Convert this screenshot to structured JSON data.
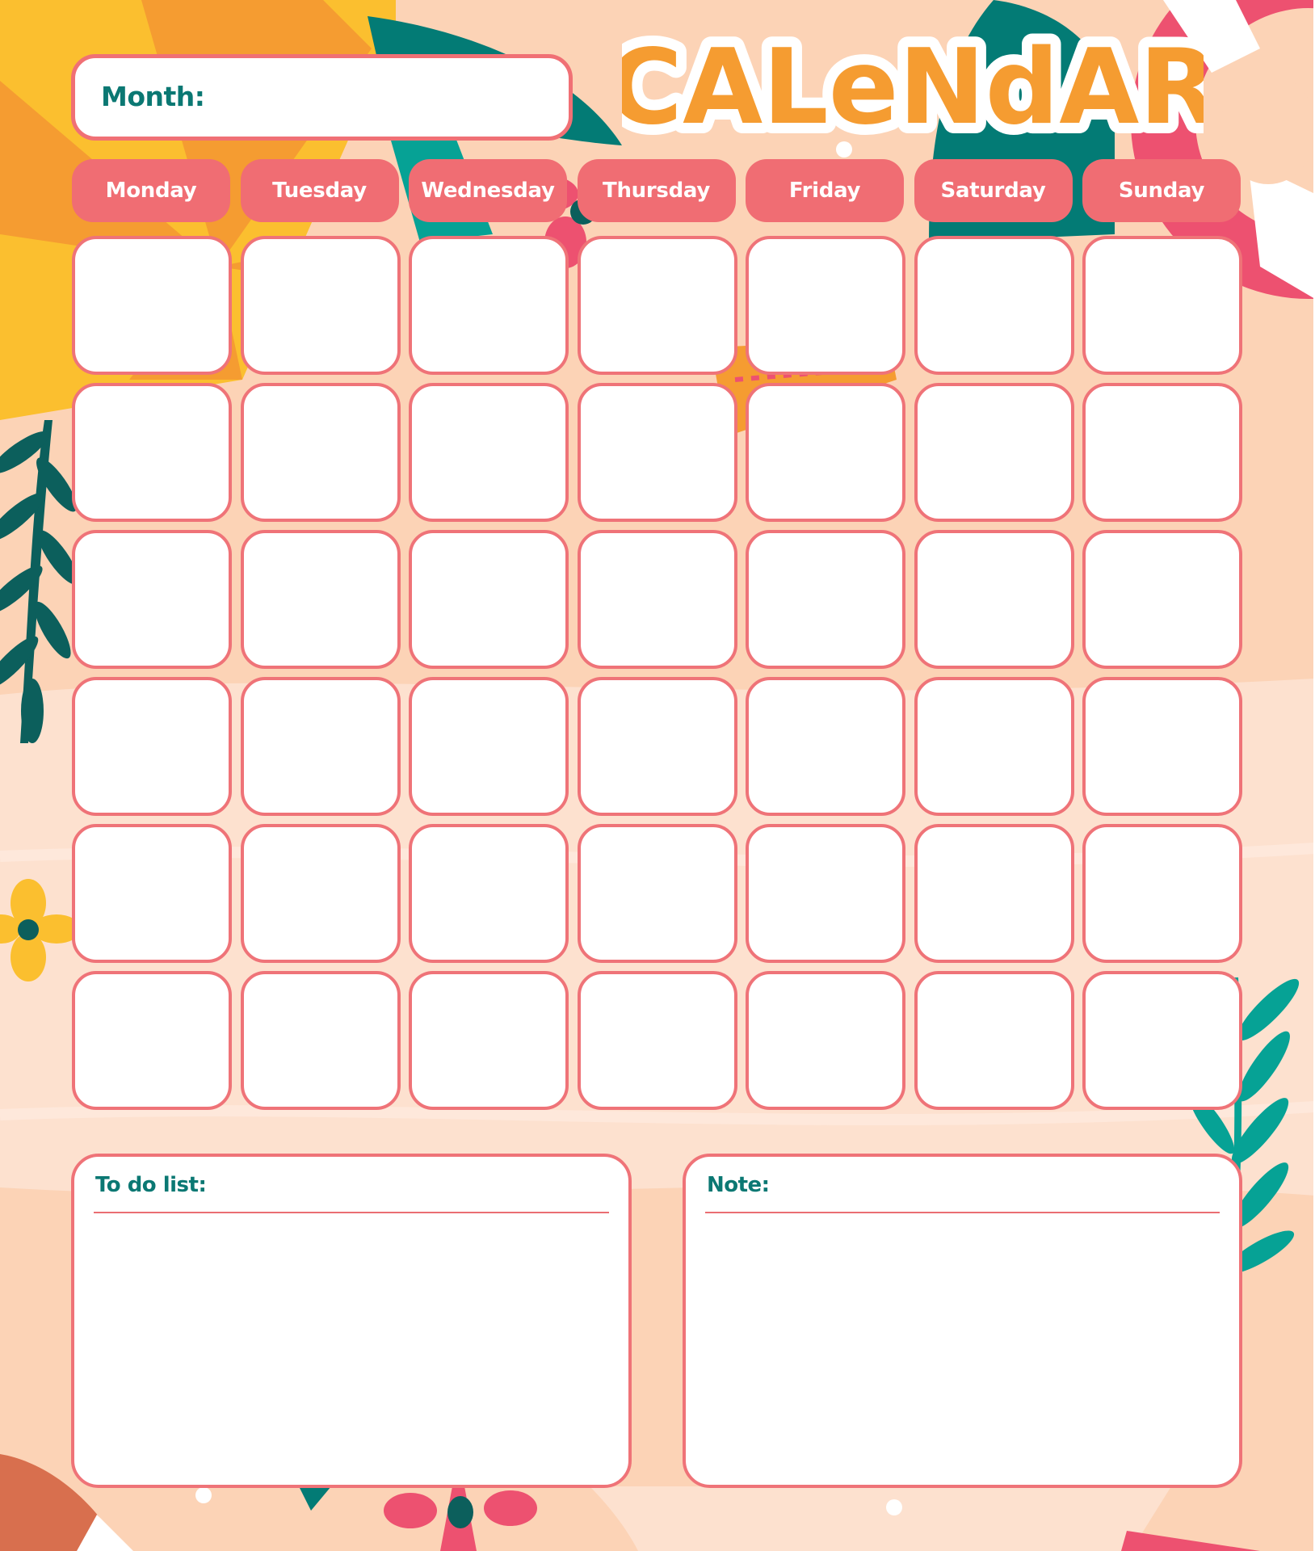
{
  "header": {
    "month_label": "Month:",
    "title": "CALeNdAR"
  },
  "weekdays": [
    "Monday",
    "Tuesday",
    "Wednesday",
    "Thursday",
    "Friday",
    "Saturday",
    "Sunday"
  ],
  "grid": {
    "rows": 6,
    "columns": 7
  },
  "panels": {
    "todo_label": "To do list:",
    "note_label": "Note:"
  },
  "colors": {
    "accent_pink": "#f06d73",
    "border_pink": "#ef7378",
    "teal_text": "#0b7873",
    "title_orange": "#f59c31",
    "background_peach": "#fcd3b6"
  }
}
